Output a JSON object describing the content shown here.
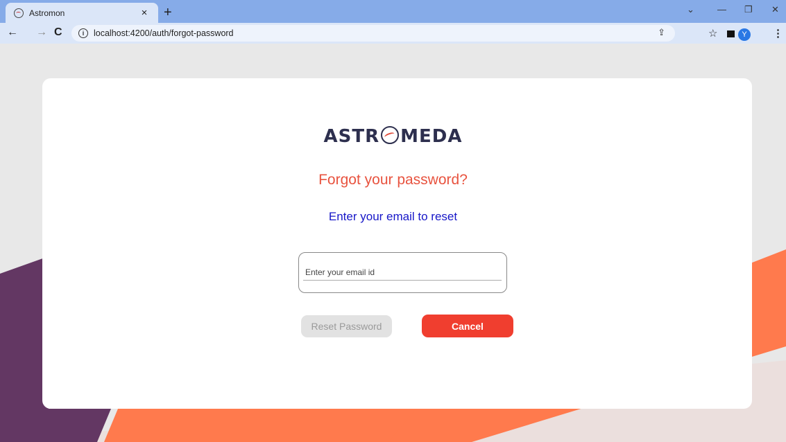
{
  "browser": {
    "tab_title": "Astromon",
    "tab_close": "×",
    "new_tab": "+",
    "url": "localhost:4200/auth/forgot-password",
    "avatar_letter": "Y"
  },
  "page": {
    "logo_left": "ASTR",
    "logo_right": "MEDA",
    "heading": "Forgot your password?",
    "subheading": "Enter your email to reset",
    "email_placeholder": "Enter your email id",
    "reset_button": "Reset Password",
    "cancel_button": "Cancel"
  },
  "colors": {
    "accent_orange": "#ff7a4d",
    "accent_purple": "#633763",
    "heading": "#e8533f",
    "subheading": "#1616c8",
    "cancel_bg": "#f03e2f"
  }
}
